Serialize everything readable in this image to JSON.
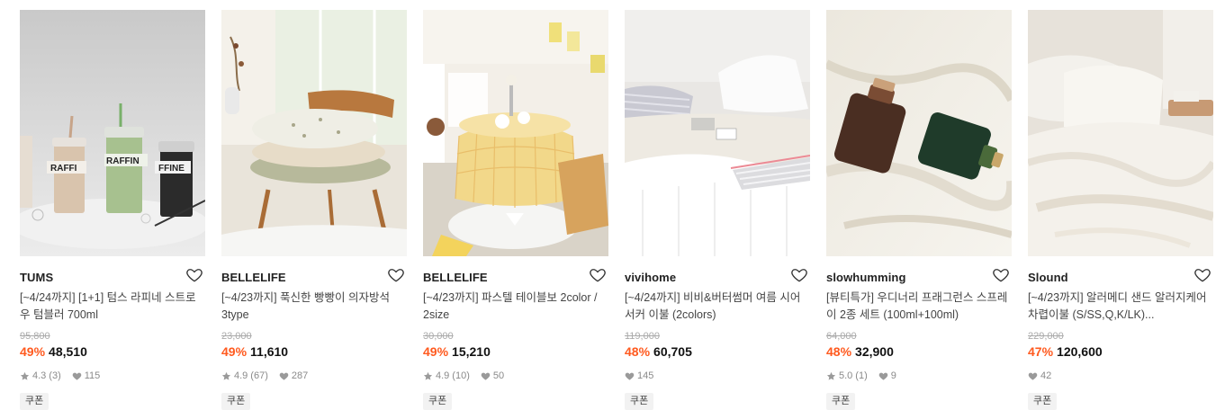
{
  "products": [
    {
      "brand": "TUMS",
      "title": "[~4/24까지] [1+1] 텀스 라피네 스트로우 텀블러 700ml",
      "original_price": "95,800",
      "discount": "49%",
      "price": "48,510",
      "rating": "4.3",
      "reviews": "(3)",
      "likes": "115",
      "coupon": "쿠폰",
      "image_desc": "tumblers",
      "image_text": [
        "RAFFI",
        "RAFFIN",
        "FFINE"
      ]
    },
    {
      "brand": "BELLELIFE",
      "title": "[~4/23까지] 푹신한 빵빵이 의자방석 3type",
      "original_price": "23,000",
      "discount": "49%",
      "price": "11,610",
      "rating": "4.9",
      "reviews": "(67)",
      "likes": "287",
      "coupon": "쿠폰",
      "image_desc": "chair cushions"
    },
    {
      "brand": "BELLELIFE",
      "title": "[~4/23까지] 파스텔 테이블보 2color / 2size",
      "original_price": "30,000",
      "discount": "49%",
      "price": "15,210",
      "rating": "4.9",
      "reviews": "(10)",
      "likes": "50",
      "coupon": "쿠폰",
      "image_desc": "table cloth"
    },
    {
      "brand": "vivihome",
      "title": "[~4/24까지] 비비&버터썸머 여름 시어서커 이불 (2colors)",
      "original_price": "119,000",
      "discount": "48%",
      "price": "60,705",
      "rating": "",
      "reviews": "",
      "likes": "145",
      "coupon": "쿠폰",
      "image_desc": "bed"
    },
    {
      "brand": "slowhumming",
      "title": "[뷰티특가] 우디너리 프래그런스 스프레이 2종 세트 (100ml+100ml)",
      "original_price": "64,000",
      "discount": "48%",
      "price": "32,900",
      "rating": "5.0",
      "reviews": "(1)",
      "likes": "9",
      "coupon": "쿠폰",
      "image_desc": "fragrance bottles"
    },
    {
      "brand": "Slound",
      "title": "[~4/23까지] 알러메디 샌드 알러지케어 차렵이불 (S/SS,Q,K/LK)...",
      "original_price": "229,000",
      "discount": "47%",
      "price": "120,600",
      "rating": "",
      "reviews": "",
      "likes": "42",
      "coupon": "쿠폰",
      "image_desc": "bedding"
    }
  ],
  "colors": {
    "discount": "#ff5a1f",
    "muted": "#8a8a8a",
    "strike": "#aaaaaa"
  },
  "icons": {
    "wish": "heart-outline-icon",
    "star": "star-icon",
    "like": "heart-icon"
  }
}
